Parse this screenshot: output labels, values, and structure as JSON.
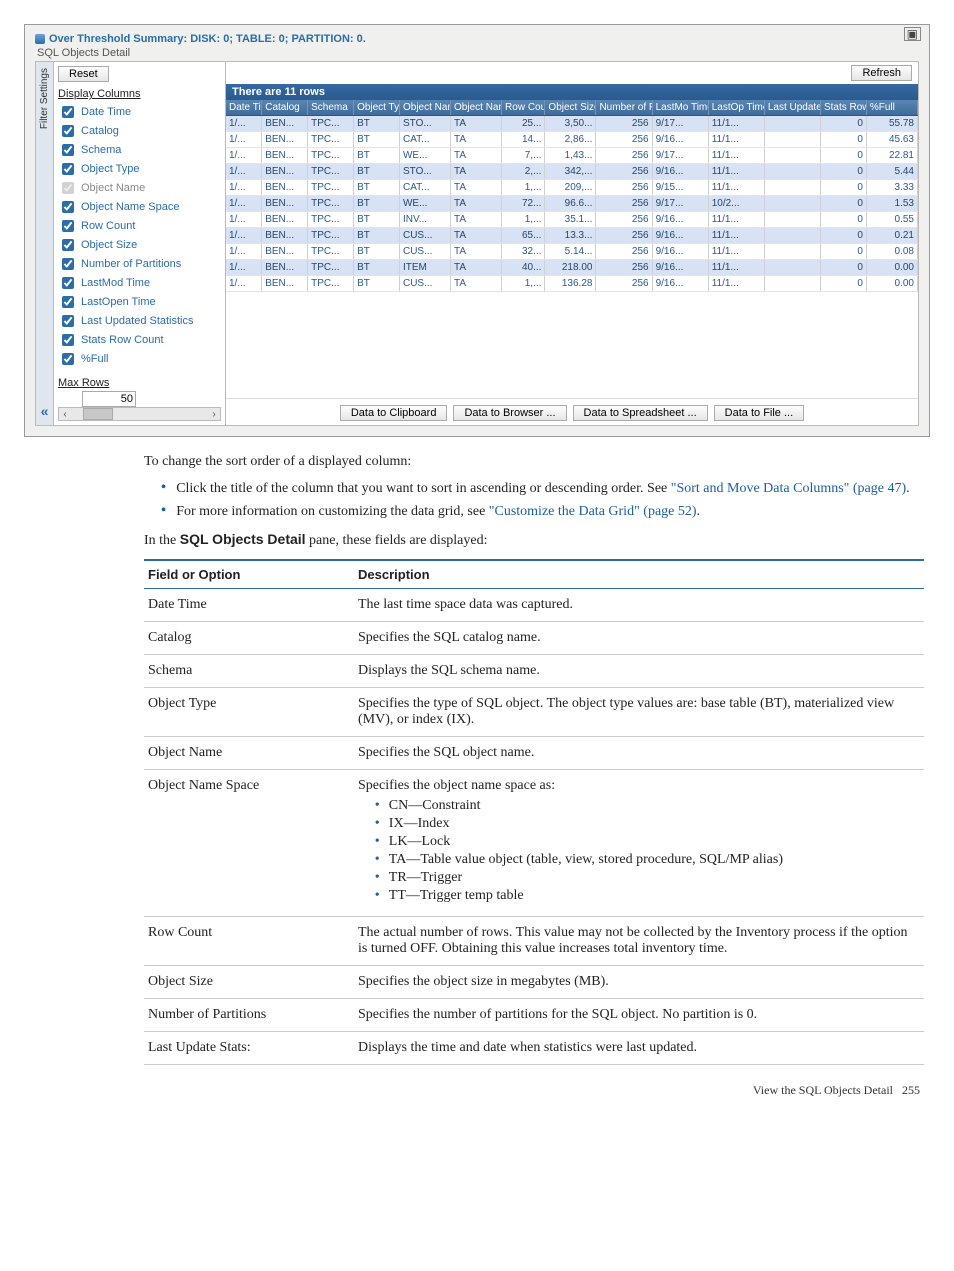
{
  "shot": {
    "window_title": "Over Threshold Summary: DISK: 0; TABLE: 0; PARTITION: 0.",
    "fieldset_label": "SQL Objects Detail",
    "reset_label": "Reset",
    "refresh_label": "Refresh",
    "vtab_label": "Filter Settings",
    "collapse_glyph": "«",
    "maximize_glyph": "▣",
    "display_columns_heading": "Display Columns",
    "max_rows_heading": "Max Rows",
    "max_rows_value": "50",
    "columns_checks": [
      {
        "label": "Date Time",
        "checked": true,
        "disabled": false
      },
      {
        "label": "Catalog",
        "checked": true,
        "disabled": false
      },
      {
        "label": "Schema",
        "checked": true,
        "disabled": false
      },
      {
        "label": "Object Type",
        "checked": true,
        "disabled": false
      },
      {
        "label": "Object Name",
        "checked": true,
        "disabled": true
      },
      {
        "label": "Object Name Space",
        "checked": true,
        "disabled": false
      },
      {
        "label": "Row Count",
        "checked": true,
        "disabled": false
      },
      {
        "label": "Object Size",
        "checked": true,
        "disabled": false
      },
      {
        "label": "Number of Partitions",
        "checked": true,
        "disabled": false
      },
      {
        "label": "LastMod Time",
        "checked": true,
        "disabled": false
      },
      {
        "label": "LastOpen Time",
        "checked": true,
        "disabled": false
      },
      {
        "label": "Last Updated Statistics",
        "checked": true,
        "disabled": false
      },
      {
        "label": "Stats Row Count",
        "checked": true,
        "disabled": false
      },
      {
        "label": "%Full",
        "checked": true,
        "disabled": false
      }
    ],
    "summary_bar": "There are 11 rows",
    "headers": [
      "Date Time",
      "Catalog",
      "Schema",
      "Object Type",
      "Object Name",
      "Object Name Space",
      "Row Count",
      "Object Size",
      "Number of Partition",
      "LastMo Time",
      "LastOp Time",
      "Last Update Statistic",
      "Stats Row Count",
      "%Full"
    ],
    "rows": [
      {
        "hi": true,
        "cells": [
          "1/...",
          "BEN...",
          "TPC...",
          "BT",
          "STO...",
          "TA",
          "25...",
          "3,50...",
          "256",
          "9/17...",
          "11/1...",
          "",
          "0",
          "55.78"
        ]
      },
      {
        "hi": false,
        "cells": [
          "1/...",
          "BEN...",
          "TPC...",
          "BT",
          "CAT...",
          "TA",
          "14...",
          "2,86...",
          "256",
          "9/16...",
          "11/1...",
          "",
          "0",
          "45.63"
        ]
      },
      {
        "hi": false,
        "cells": [
          "1/...",
          "BEN...",
          "TPC...",
          "BT",
          "WE...",
          "TA",
          "7,...",
          "1,43...",
          "256",
          "9/17...",
          "11/1...",
          "",
          "0",
          "22.81"
        ]
      },
      {
        "hi": true,
        "cells": [
          "1/...",
          "BEN...",
          "TPC...",
          "BT",
          "STO...",
          "TA",
          "2,...",
          "342,...",
          "256",
          "9/16...",
          "11/1...",
          "",
          "0",
          "5.44"
        ]
      },
      {
        "hi": false,
        "cells": [
          "1/...",
          "BEN...",
          "TPC...",
          "BT",
          "CAT...",
          "TA",
          "1,...",
          "209,...",
          "256",
          "9/15...",
          "11/1...",
          "",
          "0",
          "3.33"
        ]
      },
      {
        "hi": true,
        "cells": [
          "1/...",
          "BEN...",
          "TPC...",
          "BT",
          "WE...",
          "TA",
          "72...",
          "96.6...",
          "256",
          "9/17...",
          "10/2...",
          "",
          "0",
          "1.53"
        ]
      },
      {
        "hi": false,
        "cells": [
          "1/...",
          "BEN...",
          "TPC...",
          "BT",
          "INV...",
          "TA",
          "1,...",
          "35.1...",
          "256",
          "9/16...",
          "11/1...",
          "",
          "0",
          "0.55"
        ]
      },
      {
        "hi": true,
        "cells": [
          "1/...",
          "BEN...",
          "TPC...",
          "BT",
          "CUS...",
          "TA",
          "65...",
          "13.3...",
          "256",
          "9/16...",
          "11/1...",
          "",
          "0",
          "0.21"
        ]
      },
      {
        "hi": false,
        "cells": [
          "1/...",
          "BEN...",
          "TPC...",
          "BT",
          "CUS...",
          "TA",
          "32...",
          "5.14...",
          "256",
          "9/16...",
          "11/1...",
          "",
          "0",
          "0.08"
        ]
      },
      {
        "hi": true,
        "cells": [
          "1/...",
          "BEN...",
          "TPC...",
          "BT",
          "ITEM",
          "TA",
          "40...",
          "218.00",
          "256",
          "9/16...",
          "11/1...",
          "",
          "0",
          "0.00"
        ]
      },
      {
        "hi": false,
        "cells": [
          "1/...",
          "BEN...",
          "TPC...",
          "BT",
          "CUS...",
          "TA",
          "1,...",
          "136.28",
          "256",
          "9/16...",
          "11/1...",
          "",
          "0",
          "0.00"
        ]
      }
    ],
    "actions": [
      "Data to Clipboard",
      "Data to Browser ...",
      "Data to Spreadsheet ...",
      "Data to File ..."
    ]
  },
  "body": {
    "intro": "To change the sort order of a displayed column:",
    "b1_prefix": "Click the title of the column that you want to sort in ascending or descending order. See ",
    "b1_link": "\"Sort and Move Data Columns\" (page 47)",
    "b1_suffix": ".",
    "b2_prefix": "For more information on customizing the data grid, see ",
    "b2_link": "\"Customize the Data Grid\" (page 52)",
    "b2_suffix": ".",
    "pane_sentence_pre": "In the ",
    "pane_name": "SQL Objects Detail",
    "pane_sentence_post": " pane, these fields are displayed:",
    "th1": "Field or Option",
    "th2": "Description",
    "rows": {
      "r0": {
        "f": "Date Time",
        "d": "The last time space data was captured."
      },
      "r1": {
        "f": "Catalog",
        "d": "Specifies the SQL catalog name."
      },
      "r2": {
        "f": "Schema",
        "d": "Displays the SQL schema name."
      },
      "r3": {
        "f": "Object Type",
        "d": "Specifies the type of SQL object. The object type values are: base table (BT), materialized view (MV), or index (IX)."
      },
      "r4": {
        "f": "Object Name",
        "d": "Specifies the SQL object name."
      },
      "r5": {
        "f": "Object Name Space",
        "d": "Specifies the object name space as:",
        "items": [
          "CN—Constraint",
          "IX—Index",
          "LK—Lock",
          "TA—Table value object (table, view, stored procedure, SQL/MP alias)",
          "TR—Trigger",
          "TT—Trigger temp table"
        ]
      },
      "r6": {
        "f": "Row Count",
        "d": "The actual number of rows. This value may not be collected by the Inventory process if the option is turned OFF. Obtaining this value increases total inventory time."
      },
      "r7": {
        "f": "Object Size",
        "d": "Specifies the object size in megabytes (MB)."
      },
      "r8": {
        "f": "Number of Partitions",
        "d": "Specifies the number of partitions for the SQL object. No partition is 0."
      },
      "r9": {
        "f": "Last Update Stats:",
        "d": "Displays the time and date when statistics were last updated."
      }
    }
  },
  "footer": {
    "text": "View the SQL Objects Detail",
    "page": "255"
  }
}
